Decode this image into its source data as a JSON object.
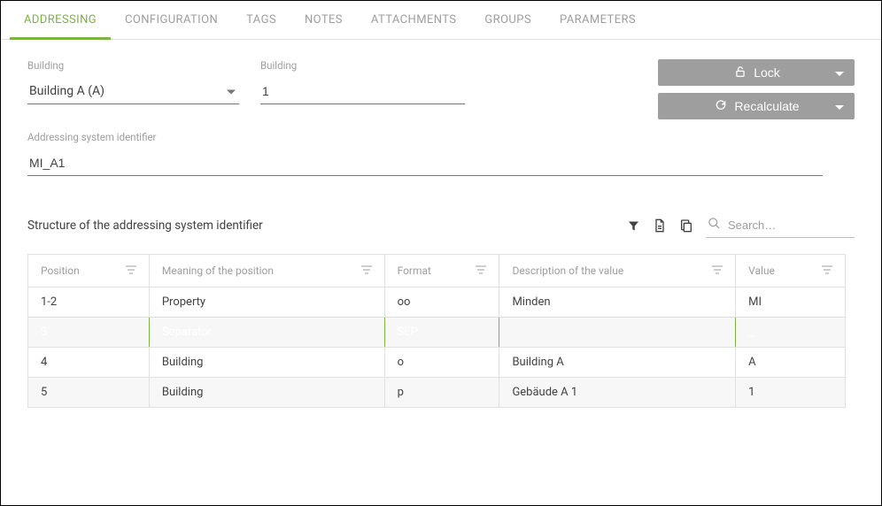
{
  "tabs": [
    {
      "label": "ADDRESSING"
    },
    {
      "label": "CONFIGURATION"
    },
    {
      "label": "TAGS"
    },
    {
      "label": "NOTES"
    },
    {
      "label": "ATTACHMENTS"
    },
    {
      "label": "GROUPS"
    },
    {
      "label": "PARAMETERS"
    }
  ],
  "active_tab": 0,
  "form": {
    "building_select_label": "Building",
    "building_select_value": "Building A (A)",
    "building_num_label": "Building",
    "building_num_value": "1",
    "addr_id_label": "Addressing system identifier",
    "addr_id_value": "MI_A1"
  },
  "actions": {
    "lock_label": "Lock",
    "recalc_label": "Recalculate"
  },
  "structure": {
    "title": "Structure of the addressing system identifier",
    "search_placeholder": "Search…",
    "columns": {
      "position": "Position",
      "meaning": "Meaning of the position",
      "format": "Format",
      "desc": "Description of the value",
      "value": "Value"
    },
    "rows": [
      {
        "position": "1-2",
        "meaning": "Property",
        "format": "oo",
        "desc": "Minden",
        "value": "MI",
        "selected": false
      },
      {
        "position": "3",
        "meaning": "Separator",
        "format": "SEP",
        "desc": "",
        "value": "_",
        "selected": true
      },
      {
        "position": "4",
        "meaning": "Building",
        "format": "o",
        "desc": "Building A",
        "value": "A",
        "selected": false
      },
      {
        "position": "5",
        "meaning": "Building",
        "format": "p",
        "desc": "Gebäude A 1",
        "value": "1",
        "selected": false
      }
    ]
  }
}
